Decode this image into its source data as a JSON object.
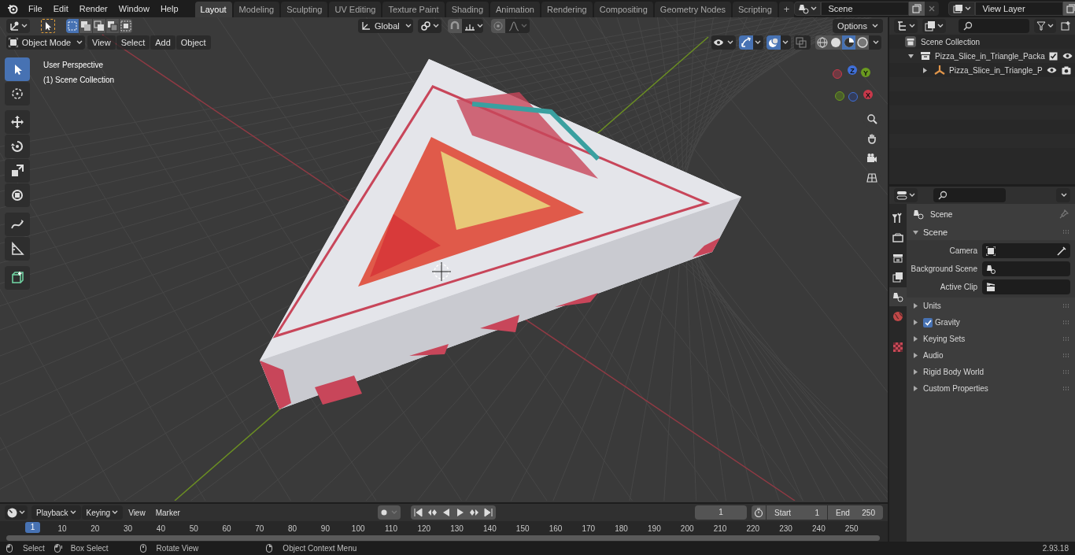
{
  "menu_bar": {
    "menus": [
      "File",
      "Edit",
      "Render",
      "Window",
      "Help"
    ]
  },
  "workspace_tabs": [
    {
      "label": "Layout",
      "selected": true
    },
    {
      "label": "Modeling",
      "selected": false
    },
    {
      "label": "Sculpting",
      "selected": false
    },
    {
      "label": "UV Editing",
      "selected": false
    },
    {
      "label": "Texture Paint",
      "selected": false
    },
    {
      "label": "Shading",
      "selected": false
    },
    {
      "label": "Animation",
      "selected": false
    },
    {
      "label": "Rendering",
      "selected": false
    },
    {
      "label": "Compositing",
      "selected": false
    },
    {
      "label": "Geometry Nodes",
      "selected": false
    },
    {
      "label": "Scripting",
      "selected": false
    }
  ],
  "add_tab": "+",
  "scene_field": {
    "value": "Scene"
  },
  "view_layer_field": {
    "value": "View Layer"
  },
  "tool_settings": {
    "select_modes": [
      {
        "selected": true
      },
      {
        "selected": false
      },
      {
        "selected": false
      },
      {
        "selected": false
      },
      {
        "selected": false
      }
    ],
    "orientation": "Global",
    "options": "Options"
  },
  "viewport_header": {
    "mode": "Object Mode",
    "menus": [
      "View",
      "Select",
      "Add",
      "Object"
    ],
    "toggles": [
      {
        "kind": "visibility",
        "on": false
      },
      {
        "kind": "gizmo",
        "on": true
      },
      {
        "kind": "overlay",
        "on": true
      },
      {
        "kind": "xray",
        "on": false
      }
    ],
    "shading": [
      {
        "kind": "wireframe",
        "selected": false
      },
      {
        "kind": "solid",
        "selected": false
      },
      {
        "kind": "material",
        "selected": true
      },
      {
        "kind": "rendered",
        "selected": false
      }
    ]
  },
  "toolbar": [
    {
      "kind": "select",
      "selected": true
    },
    {
      "kind": "cursor",
      "selected": false
    },
    {
      "kind": "move",
      "selected": false
    },
    {
      "kind": "rotate",
      "selected": false
    },
    {
      "kind": "scale",
      "selected": false
    },
    {
      "kind": "transform",
      "selected": false
    },
    {
      "kind": "annotate",
      "selected": false
    },
    {
      "kind": "measure",
      "selected": false
    },
    {
      "kind": "add_cube",
      "selected": false
    }
  ],
  "viewport_info": {
    "view_name": "User Perspective",
    "collection": "(1) Scene Collection"
  },
  "gizmo": {
    "axes": [
      "X",
      "Y",
      "Z"
    ]
  },
  "outliner": {
    "root": "Scene Collection",
    "items": [
      {
        "label": "Pizza_Slice_in_Triangle_Packa",
        "kind": "collection",
        "expanded": true,
        "checked": true,
        "children": [
          {
            "label": "Pizza_Slice_in_Triangle_P",
            "kind": "object",
            "expanded": false
          }
        ]
      }
    ]
  },
  "properties": {
    "tabs": [
      {
        "kind": "tool",
        "selected": false
      },
      {
        "kind": "render",
        "selected": false
      },
      {
        "kind": "output",
        "selected": false
      },
      {
        "kind": "view_layer",
        "selected": false
      },
      {
        "kind": "scene",
        "selected": true
      },
      {
        "kind": "world",
        "selected": false
      },
      {
        "kind": "texture",
        "selected": false
      }
    ],
    "context": "Scene",
    "panel": {
      "title": "Scene",
      "expanded": true,
      "fields": [
        {
          "label": "Camera",
          "kind": "camera"
        },
        {
          "label": "Background Scene",
          "kind": "scene"
        },
        {
          "label": "Active Clip",
          "kind": "clip"
        }
      ]
    },
    "sections": [
      {
        "title": "Units",
        "expanded": false
      },
      {
        "title": "Gravity",
        "expanded": false,
        "checked": true
      },
      {
        "title": "Keying Sets",
        "expanded": false
      },
      {
        "title": "Audio",
        "expanded": false
      },
      {
        "title": "Rigid Body World",
        "expanded": false
      },
      {
        "title": "Custom Properties",
        "expanded": false
      }
    ]
  },
  "timeline": {
    "menus": [
      "Playback",
      "Keying",
      "View",
      "Marker"
    ],
    "current_frame": "1",
    "start_label": "Start",
    "start": "1",
    "end_label": "End",
    "end": "250",
    "playhead": "1",
    "ticks": [
      "10",
      "20",
      "30",
      "40",
      "50",
      "60",
      "70",
      "80",
      "90",
      "100",
      "110",
      "120",
      "130",
      "140",
      "150",
      "160",
      "170",
      "180",
      "190",
      "200",
      "210",
      "220",
      "230",
      "240",
      "250"
    ]
  },
  "status_bar": {
    "hints": [
      "Select",
      "Box Select",
      "Rotate View",
      "Object Context Menu"
    ],
    "version": "2.93.18"
  }
}
